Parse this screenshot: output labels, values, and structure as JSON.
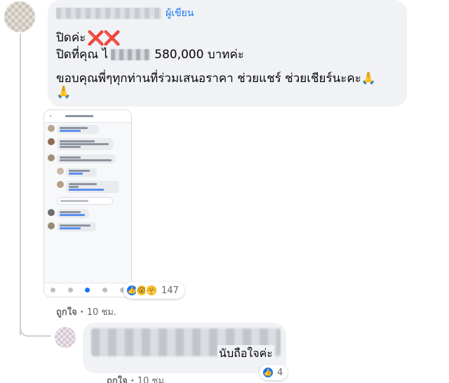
{
  "comment": {
    "author_badge": "ผู้เขียน",
    "line1": "ปิดค่ะ",
    "line1_marks": "❌❌",
    "line2_prefix": "ปิดที่คุณ ไ",
    "line2_amount": "580,000 บาทค่ะ",
    "line3": "ขอบคุณพี่ๆทุกท่านที่ร่วมเสนอราคา ช่วยแชร์ ช่วยเชียร์นะคะ",
    "line3_emoji": "🙏",
    "line4_emoji": "🙏",
    "reaction_count": "147",
    "reaction_icons": [
      "like-icon",
      "wow-icon",
      "care-icon"
    ],
    "like_label": "ถูกใจ",
    "separator": " · ",
    "timestamp": "10 ชม."
  },
  "reply": {
    "text": "นับถือใจค่ะ",
    "reaction_count": "4",
    "like_label": "ถูกใจ",
    "separator": " · ",
    "timestamp": "10 ชม."
  },
  "colors": {
    "bubble_bg": "#f0f2f5",
    "accent": "#1877f2",
    "meta_text": "#65676b"
  }
}
